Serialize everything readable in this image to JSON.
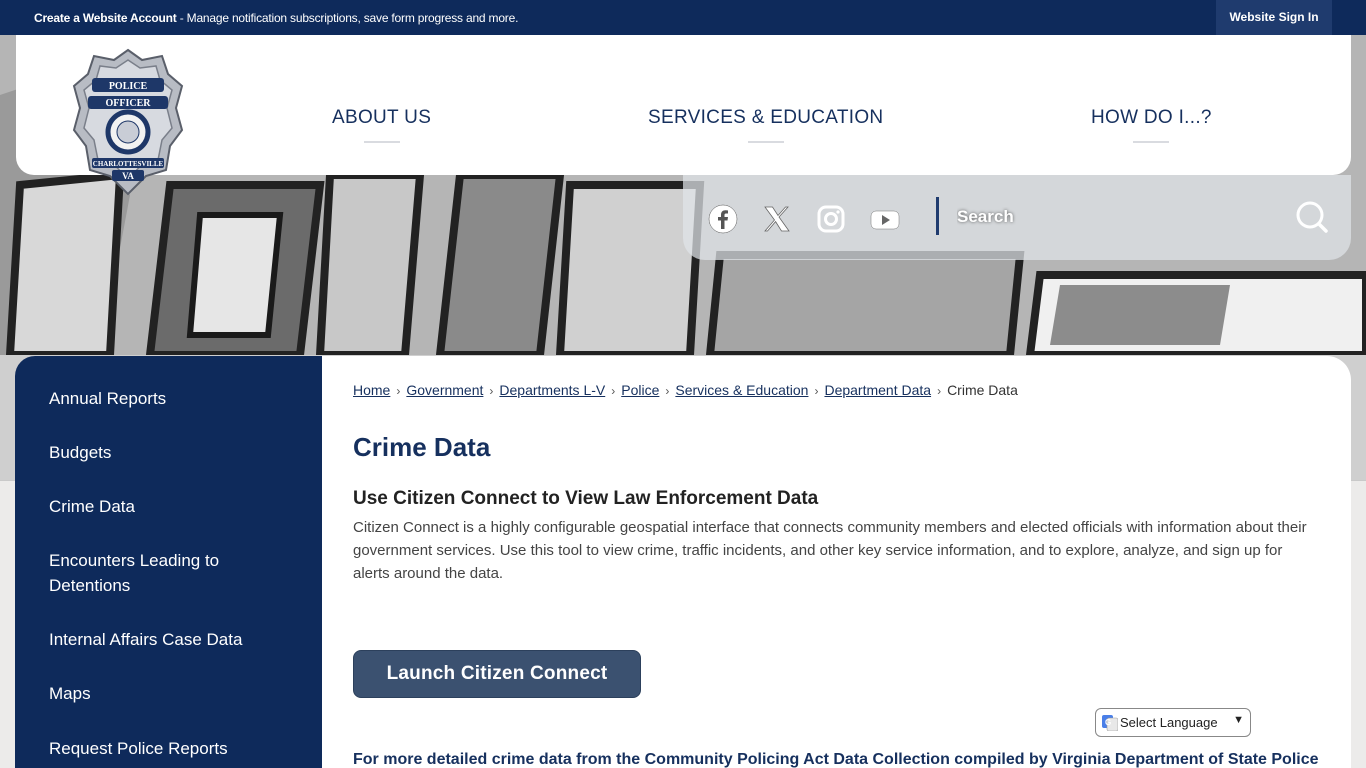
{
  "topbar": {
    "create_account": "Create a Website Account",
    "message": " - Manage notification subscriptions, save form progress and more.",
    "sign_in": "Website Sign In"
  },
  "header": {
    "logo_alt": "Police Officer badge - Charlottesville VA",
    "nav": [
      "ABOUT US",
      "SERVICES & EDUCATION",
      "HOW DO I...?"
    ]
  },
  "social": {
    "icons": [
      "facebook-icon",
      "x-icon",
      "instagram-icon",
      "youtube-icon"
    ],
    "search_placeholder": "Search"
  },
  "sidebar": {
    "items": [
      {
        "label": "Annual Reports"
      },
      {
        "label": "Budgets"
      },
      {
        "label": "Crime Data"
      },
      {
        "label": "Encounters Leading to Detentions"
      },
      {
        "label": "Internal Affairs Case Data"
      },
      {
        "label": "Maps"
      },
      {
        "label": "Request Police Reports"
      }
    ]
  },
  "breadcrumb": {
    "links": [
      "Home",
      "Government",
      "Departments L-V",
      "Police",
      "Services & Education",
      "Department Data"
    ],
    "current": "Crime Data"
  },
  "content": {
    "title": "Crime Data",
    "subtitle": "Use Citizen Connect to View Law Enforcement Data",
    "paragraph": "Citizen Connect is a highly configurable geospatial interface that connects community members and elected officials with information about their government services. Use this tool to view crime, traffic incidents, and other key service information, and to explore, analyze, and sign up for alerts around the data.",
    "launch_button": "Launch Citizen Connect",
    "more_text": "For more detailed crime data from the Community Policing Act Data Collection compiled by Virginia Department of State Police"
  },
  "language": {
    "label": "Select Language"
  },
  "colors": {
    "navy": "#0e2a5b",
    "button": "#3b5170"
  }
}
